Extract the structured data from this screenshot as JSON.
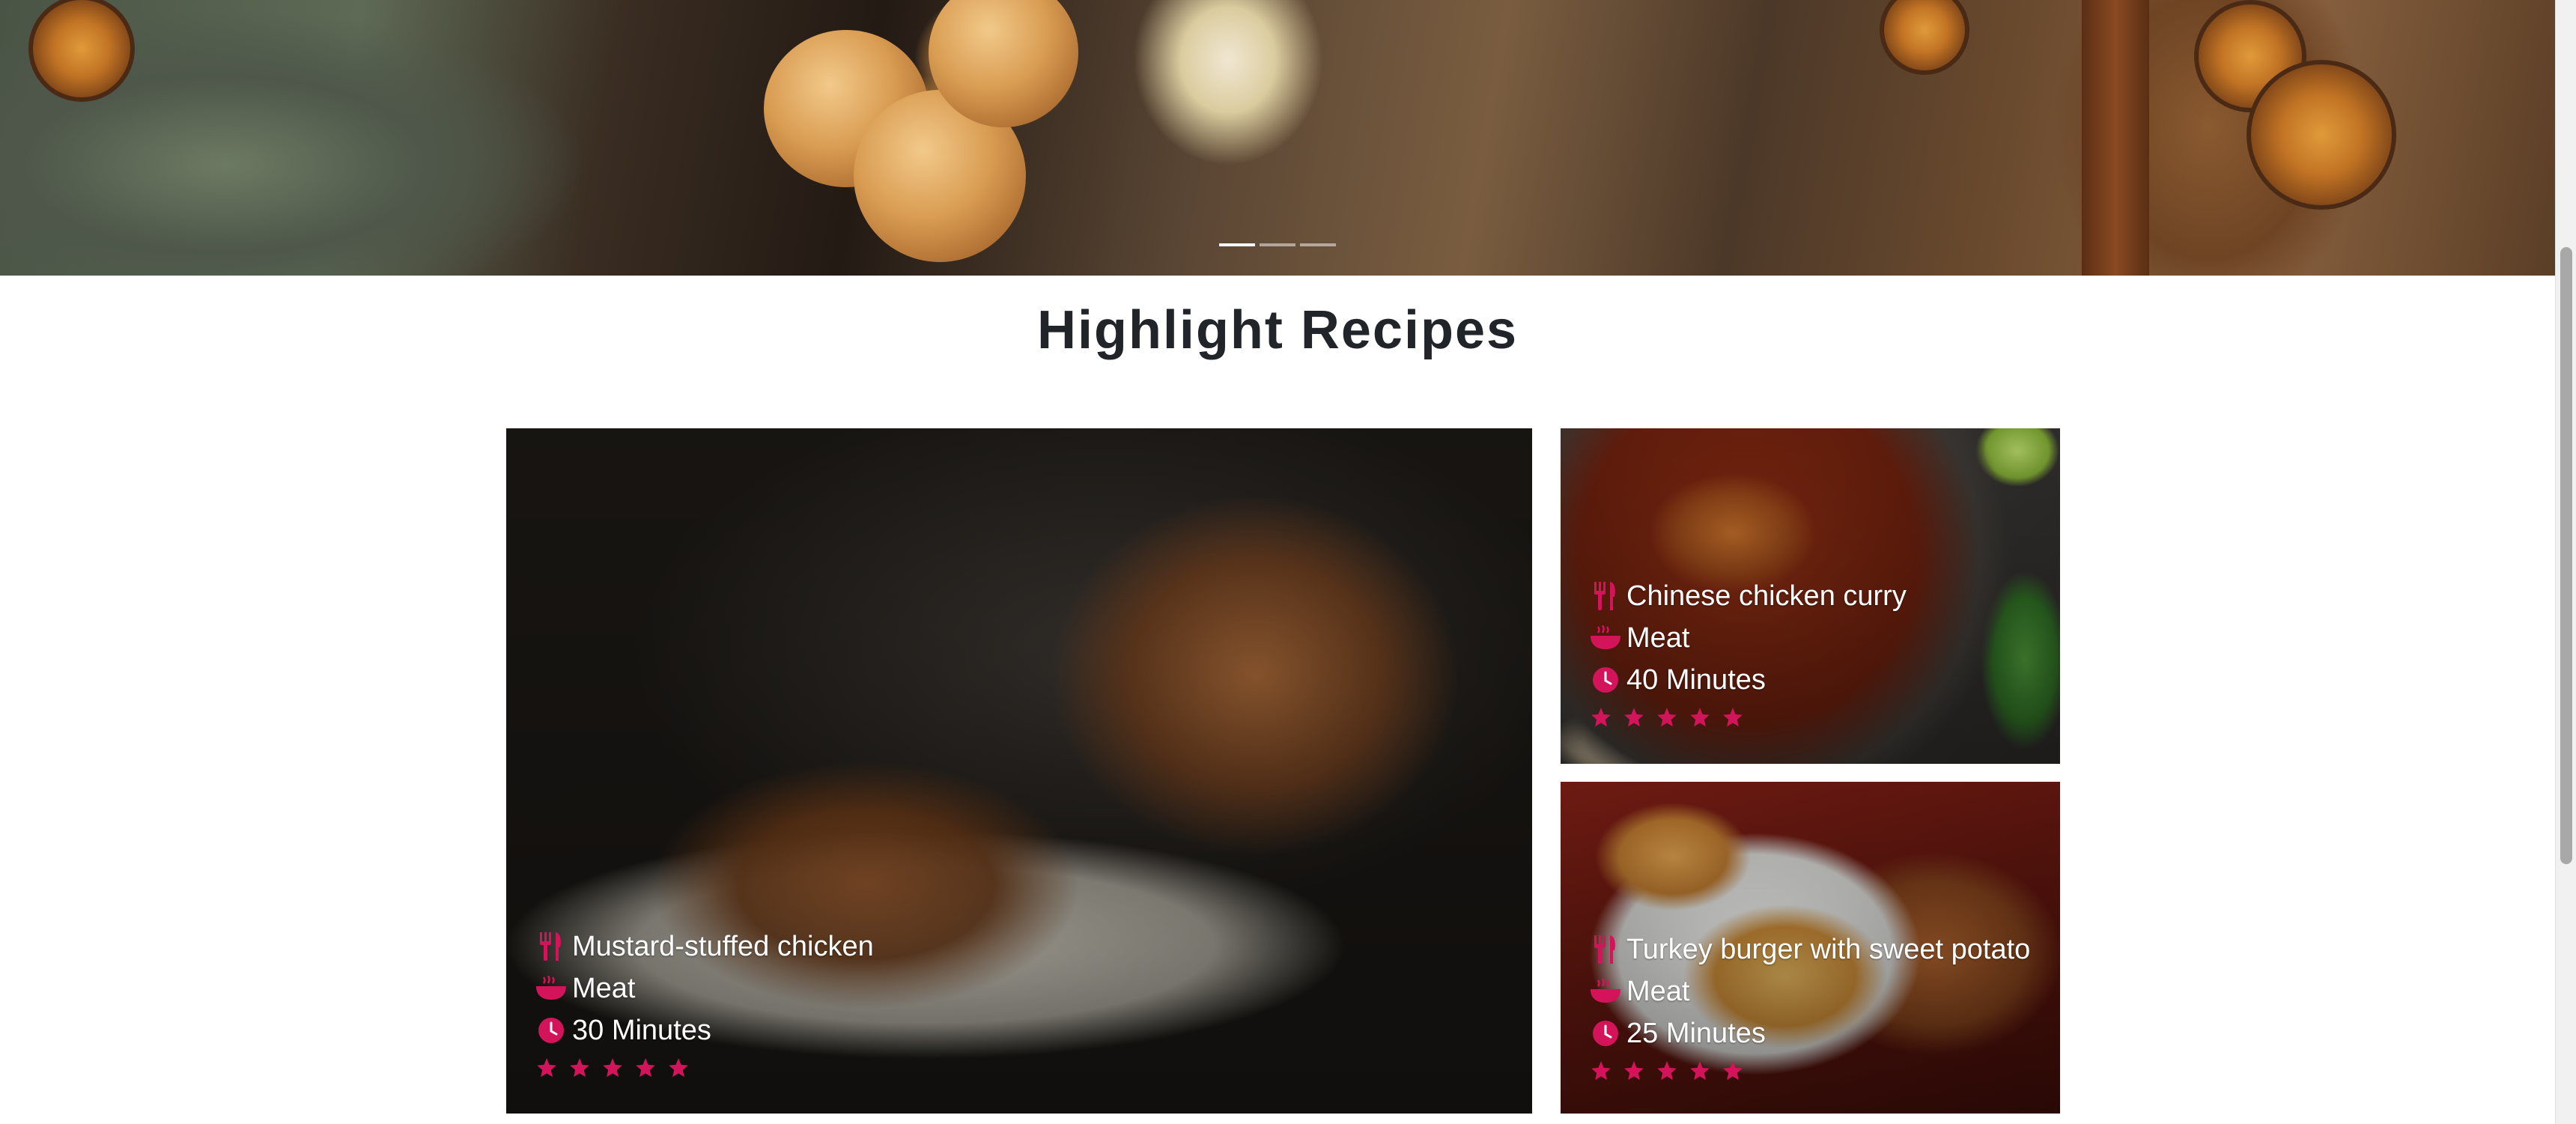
{
  "hero": {
    "indicators": [
      {
        "label": "slide-1",
        "active": true
      },
      {
        "label": "slide-2",
        "active": false
      },
      {
        "label": "slide-3",
        "active": false
      }
    ]
  },
  "section": {
    "title": "Highlight Recipes"
  },
  "colors": {
    "accent": "#d4145a",
    "title": "#212529",
    "card_text": "#ffffff"
  },
  "icons": {
    "name": "utensils-icon",
    "category": "bowl-icon",
    "time": "clock-icon",
    "rating": "star-icon"
  },
  "recipes": [
    {
      "name": "Mustard-stuffed chicken",
      "category": "Meat",
      "time": "30 Minutes",
      "rating": 5
    },
    {
      "name": "Chinese chicken curry",
      "category": "Meat",
      "time": "40 Minutes",
      "rating": 5
    },
    {
      "name": "Turkey burger with sweet potato",
      "category": "Meat",
      "time": "25 Minutes",
      "rating": 5
    }
  ]
}
